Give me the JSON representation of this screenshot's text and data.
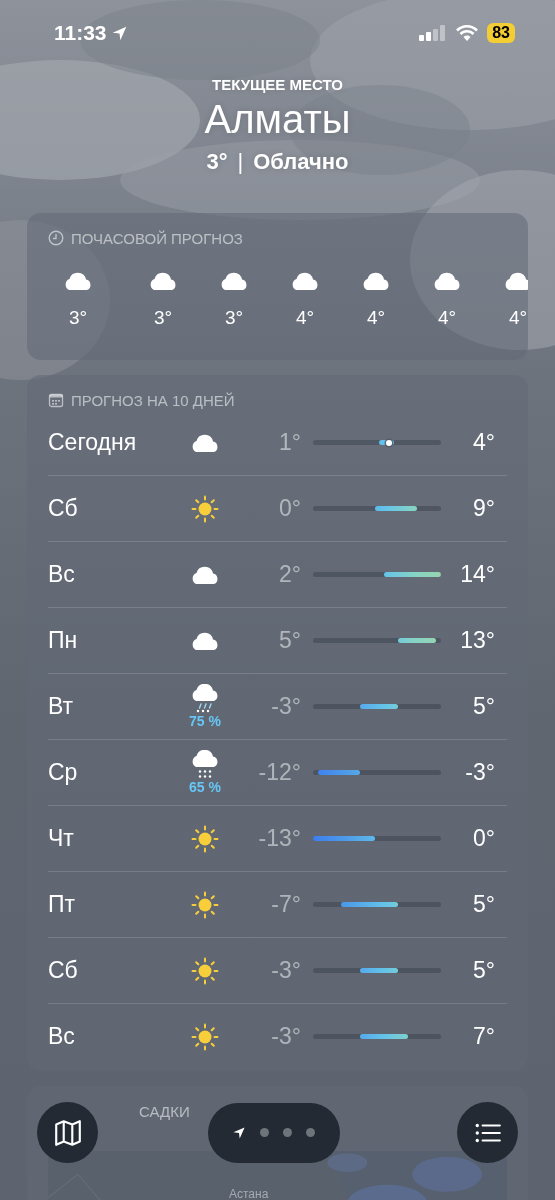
{
  "status_bar": {
    "time": "11:33",
    "battery": "83"
  },
  "location": {
    "caption": "ТЕКУЩЕЕ МЕСТО",
    "city": "Алматы",
    "temperature": "3°",
    "separator": "|",
    "condition": "Облачно"
  },
  "hourly": {
    "title": "ПОЧАСОВОЙ ПРОГНОЗ",
    "items": [
      {
        "kind": "cloud",
        "temp": "3°"
      },
      {
        "kind": "cloud",
        "temp": "3°"
      },
      {
        "kind": "cloud",
        "temp": "3°"
      },
      {
        "kind": "cloud",
        "temp": "4°"
      },
      {
        "kind": "cloud",
        "temp": "4°"
      },
      {
        "kind": "cloud",
        "temp": "4°"
      },
      {
        "kind": "cloud",
        "temp": "4°"
      }
    ]
  },
  "daily": {
    "title": "ПРОГНОЗ НА 10 ДНЕЙ",
    "days": [
      {
        "day": "Сегодня",
        "kind": "cloud",
        "low": "1°",
        "high": "4°",
        "now_marker": true
      },
      {
        "day": "Сб",
        "kind": "sun",
        "low": "0°",
        "high": "9°",
        "now_marker": false
      },
      {
        "day": "Вс",
        "kind": "cloud",
        "low": "2°",
        "high": "14°",
        "now_marker": false
      },
      {
        "day": "Пн",
        "kind": "cloud",
        "low": "5°",
        "high": "13°",
        "now_marker": false
      },
      {
        "day": "Вт",
        "kind": "sleet",
        "chance": "75 %",
        "low": "-3°",
        "high": "5°",
        "now_marker": false
      },
      {
        "day": "Ср",
        "kind": "snow",
        "chance": "65 %",
        "low": "-12°",
        "high": "-3°",
        "now_marker": false
      },
      {
        "day": "Чт",
        "kind": "sun",
        "low": "-13°",
        "high": "0°",
        "now_marker": false
      },
      {
        "day": "Пт",
        "kind": "sun",
        "low": "-7°",
        "high": "5°",
        "now_marker": false
      },
      {
        "day": "Сб",
        "kind": "sun",
        "low": "-3°",
        "high": "5°",
        "now_marker": false
      },
      {
        "day": "Вс",
        "kind": "sun",
        "low": "-3°",
        "high": "7°",
        "now_marker": false
      }
    ]
  },
  "map_card": {
    "title": "САДКИ",
    "place": "Астана"
  },
  "toolbar": {
    "pages": [
      {
        "kind": "location",
        "selected": true
      },
      {
        "kind": "dot",
        "selected": false
      },
      {
        "kind": "dot",
        "selected": false
      },
      {
        "kind": "dot",
        "selected": false
      }
    ]
  }
}
